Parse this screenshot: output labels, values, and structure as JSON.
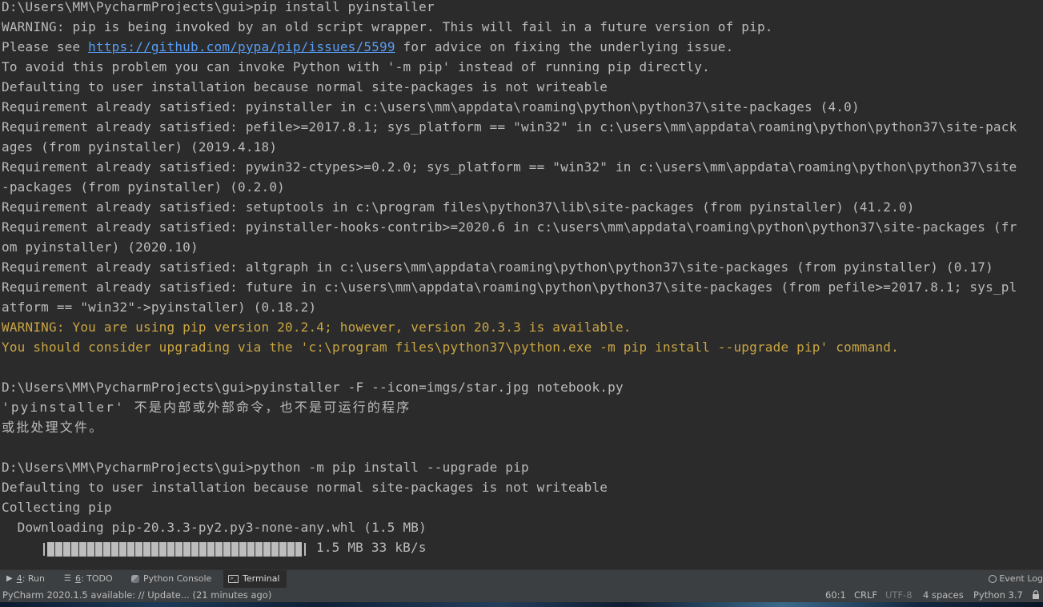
{
  "terminal": {
    "lines": [
      {
        "text": "D:\\Users\\MM\\PycharmProjects\\gui>pip install pyinstaller",
        "type": "normal"
      },
      {
        "text": "WARNING: pip is being invoked by an old script wrapper. This will fail in a future version of pip.",
        "type": "normal"
      },
      {
        "before": "Please see ",
        "link": "https://github.com/pypa/pip/issues/5599",
        "after": " for advice on fixing the underlying issue.",
        "type": "link"
      },
      {
        "text": "To avoid this problem you can invoke Python with '-m pip' instead of running pip directly.",
        "type": "normal"
      },
      {
        "text": "Defaulting to user installation because normal site-packages is not writeable",
        "type": "normal"
      },
      {
        "text": "Requirement already satisfied: pyinstaller in c:\\users\\mm\\appdata\\roaming\\python\\python37\\site-packages (4.0)",
        "type": "normal"
      },
      {
        "text": "Requirement already satisfied: pefile>=2017.8.1; sys_platform == \"win32\" in c:\\users\\mm\\appdata\\roaming\\python\\python37\\site-pack",
        "type": "normal"
      },
      {
        "text": "ages (from pyinstaller) (2019.4.18)",
        "type": "normal"
      },
      {
        "text": "Requirement already satisfied: pywin32-ctypes>=0.2.0; sys_platform == \"win32\" in c:\\users\\mm\\appdata\\roaming\\python\\python37\\site",
        "type": "normal"
      },
      {
        "text": "-packages (from pyinstaller) (0.2.0)",
        "type": "normal"
      },
      {
        "text": "Requirement already satisfied: setuptools in c:\\program files\\python37\\lib\\site-packages (from pyinstaller) (41.2.0)",
        "type": "normal"
      },
      {
        "text": "Requirement already satisfied: pyinstaller-hooks-contrib>=2020.6 in c:\\users\\mm\\appdata\\roaming\\python\\python37\\site-packages (fr",
        "type": "normal"
      },
      {
        "text": "om pyinstaller) (2020.10)",
        "type": "normal"
      },
      {
        "text": "Requirement already satisfied: altgraph in c:\\users\\mm\\appdata\\roaming\\python\\python37\\site-packages (from pyinstaller) (0.17)",
        "type": "normal"
      },
      {
        "text": "Requirement already satisfied: future in c:\\users\\mm\\appdata\\roaming\\python\\python37\\site-packages (from pefile>=2017.8.1; sys_pl",
        "type": "normal"
      },
      {
        "text": "atform == \"win32\"->pyinstaller) (0.18.2)",
        "type": "normal"
      },
      {
        "text": "WARNING: You are using pip version 20.2.4; however, version 20.3.3 is available.",
        "type": "warn"
      },
      {
        "text": "You should consider upgrading via the 'c:\\program files\\python37\\python.exe -m pip install --upgrade pip' command.",
        "type": "warn"
      },
      {
        "text": "",
        "type": "normal"
      },
      {
        "text": "D:\\Users\\MM\\PycharmProjects\\gui>pyinstaller -F --icon=imgs/star.jpg notebook.py",
        "type": "normal"
      },
      {
        "text": "'pyinstaller' 不是内部或外部命令，也不是可运行的程序",
        "type": "cjk"
      },
      {
        "text": "或批处理文件。",
        "type": "cjk"
      },
      {
        "text": "",
        "type": "normal"
      },
      {
        "text": "D:\\Users\\MM\\PycharmProjects\\gui>python -m pip install --upgrade pip",
        "type": "normal"
      },
      {
        "text": "Defaulting to user installation because normal site-packages is not writeable",
        "type": "normal"
      },
      {
        "text": "Collecting pip",
        "type": "normal"
      },
      {
        "text": "  Downloading pip-20.3.3-py2.py3-none-any.whl (1.5 MB)",
        "type": "normal"
      }
    ],
    "progress": {
      "indent": "     ",
      "fraction": 1.0,
      "label": " 1.5 MB 33 kB/s"
    }
  },
  "toolwindows": {
    "run": {
      "num": "4",
      "label": ": Run"
    },
    "todo": {
      "num": "6",
      "label": ": TODO"
    },
    "console": {
      "label": "Python Console"
    },
    "terminal": {
      "label": "Terminal"
    },
    "event_log": {
      "label": "Event Log"
    }
  },
  "statusbar": {
    "message": "PyCharm 2020.1.5 available: // Update... (21 minutes ago)",
    "position": "60:1",
    "line_sep": "CRLF",
    "encoding": "UTF-8",
    "indent": "4 spaces",
    "interpreter": "Python 3.7"
  },
  "colors": {
    "background": "#2b2b2b",
    "text": "#bbbbbb",
    "warning": "#c9a542",
    "link": "#589df6",
    "panel": "#3c3f41"
  }
}
